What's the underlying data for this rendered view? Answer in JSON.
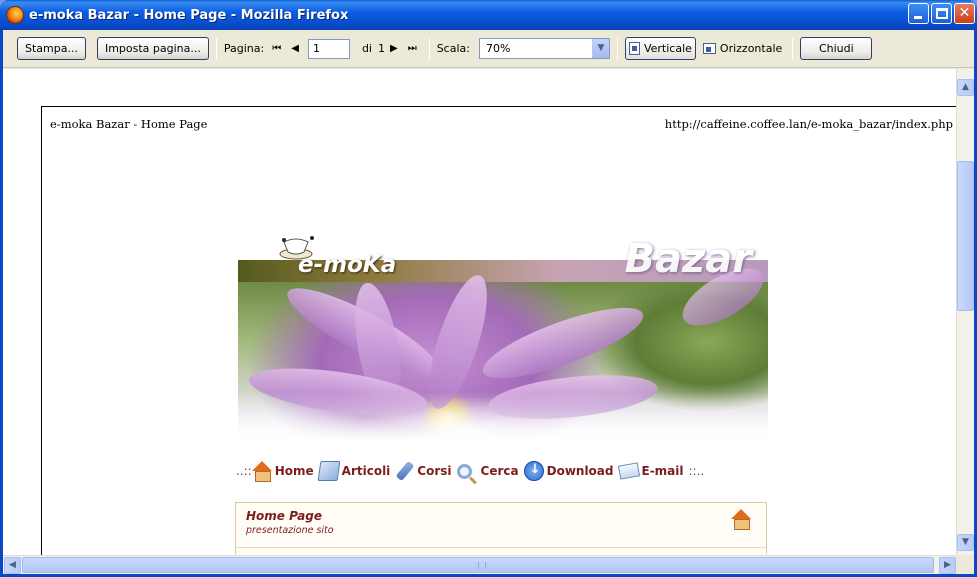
{
  "window": {
    "title": "e-moka Bazar - Home Page - Mozilla Firefox"
  },
  "toolbar": {
    "print_label": "Stampa...",
    "page_setup_label": "Imposta pagina...",
    "page_label": "Pagina:",
    "first_glyph": "⏮",
    "prev_glyph": "◀",
    "page_value": "1",
    "of_label": "di",
    "total_pages": "1",
    "next_glyph": "▶",
    "last_glyph": "⏭",
    "scale_label": "Scala:",
    "scale_value": "70%",
    "portrait_label": "Verticale",
    "landscape_label": "Orizzontale",
    "close_label": "Chiudi"
  },
  "sheet": {
    "header_left": "e-moka Bazar - Home Page",
    "header_right": "http://caffeine.coffee.lan/e-moka_bazar/index.php"
  },
  "banner": {
    "logo_left": "e-moKa",
    "logo_right": "Bazar"
  },
  "nav": {
    "prefix": "..:: ",
    "suffix": " ::..",
    "items": [
      {
        "label": "Home",
        "icon": "home-icon"
      },
      {
        "label": "Articoli",
        "icon": "book-icon"
      },
      {
        "label": "Corsi",
        "icon": "tools-icon"
      },
      {
        "label": "Cerca",
        "icon": "search-icon"
      },
      {
        "label": "Download",
        "icon": "download-icon"
      },
      {
        "label": "E-mail",
        "icon": "mail-icon"
      }
    ]
  },
  "content": {
    "title": "Home Page",
    "subtitle": "presentazione sito"
  },
  "colors": {
    "title_bar": "#0a5fd8",
    "nav_text": "#7c1d1d",
    "toolbar_bg": "#ece9d8"
  }
}
